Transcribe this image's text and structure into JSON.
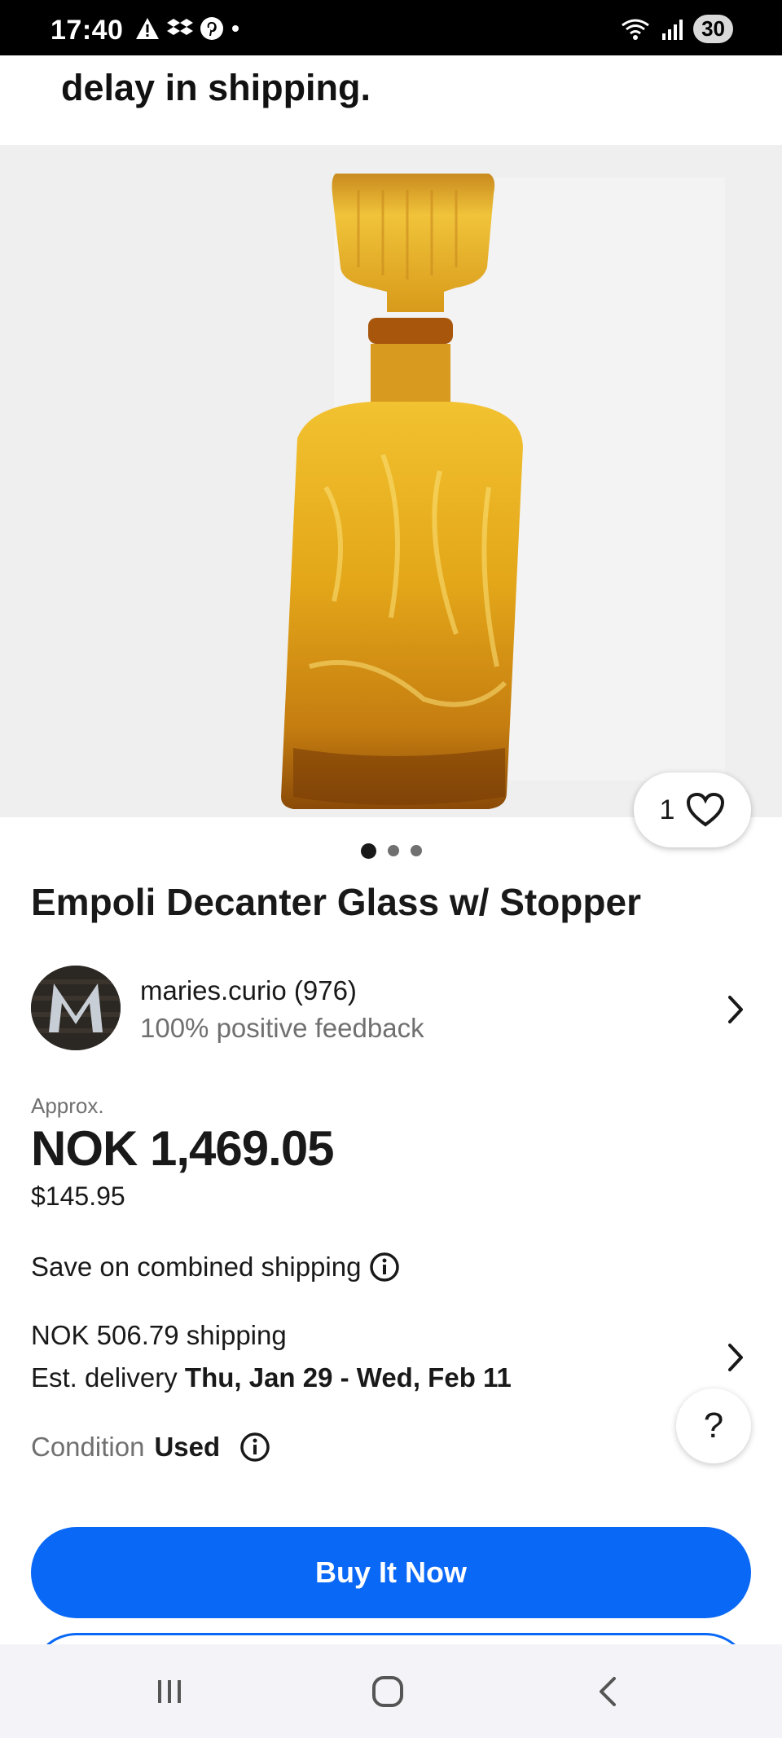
{
  "status_bar": {
    "time": "17:40",
    "battery": "30"
  },
  "top_text": "delay in shipping.",
  "listing": {
    "like_count": "1",
    "image_count": 3,
    "image_index": 1,
    "title": "Empoli Decanter Glass w/ Stopper"
  },
  "seller": {
    "name": "maries.curio (976)",
    "feedback": "100% positive feedback",
    "avatar_letter": "M"
  },
  "price": {
    "approx_label": "Approx.",
    "amount": "NOK 1,469.05",
    "usd": "$145.95"
  },
  "shipping": {
    "combined": "Save on combined shipping",
    "cost": "NOK 506.79 shipping",
    "delivery_label": "Est. delivery ",
    "delivery_dates": "Thu, Jan 29 - Wed, Feb 11"
  },
  "condition": {
    "label": "Condition",
    "value": "Used"
  },
  "help_label": "?",
  "actions": {
    "buy_now": "Buy It Now"
  },
  "colors": {
    "accent": "#0968f6",
    "text": "#191919",
    "secondary_text": "#707070"
  },
  "icons": [
    "warning-icon",
    "dropbox-icon",
    "pinterest-icon",
    "wifi-icon",
    "signal-icon",
    "heart-icon",
    "chevron-right-icon",
    "info-icon",
    "recents-icon",
    "home-icon",
    "back-icon"
  ]
}
